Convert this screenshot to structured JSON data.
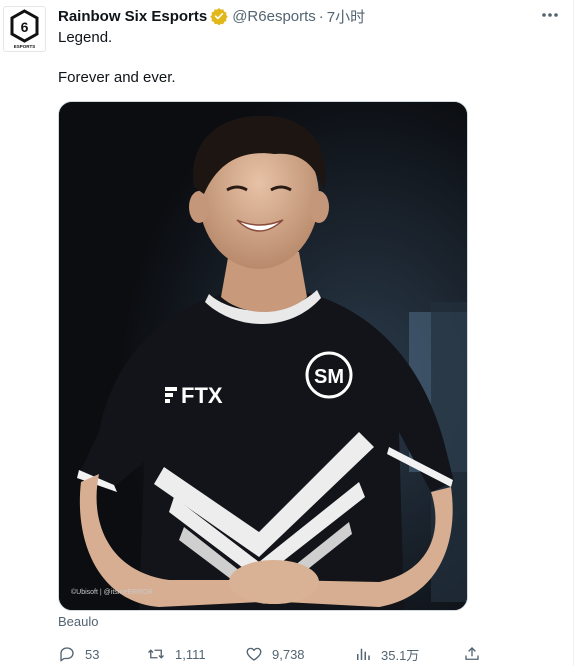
{
  "tweet": {
    "author": {
      "display_name": "Rainbow Six Esports",
      "handle": "@R6esports",
      "separator": "·",
      "time": "7小时",
      "avatar_logo_text": "ESPORTS",
      "avatar_logo_numeral": "6"
    },
    "text_lines": [
      "Legend.",
      "Forever and ever."
    ],
    "media": {
      "jersey_sponsor": "FTX",
      "jersey_badge": "SM",
      "photo_credit": "©Ubisoft | @itsmeERROR",
      "caption": "Beaulo"
    },
    "actions": {
      "replies": "53",
      "retweets": "1,111",
      "likes": "9,738",
      "views": "35.1万"
    }
  },
  "colors": {
    "verified": "#e2b719",
    "muted_text": "#536471",
    "primary_text": "#0f1419",
    "jersey": "#121419",
    "background_photo": "#0d0f13"
  }
}
